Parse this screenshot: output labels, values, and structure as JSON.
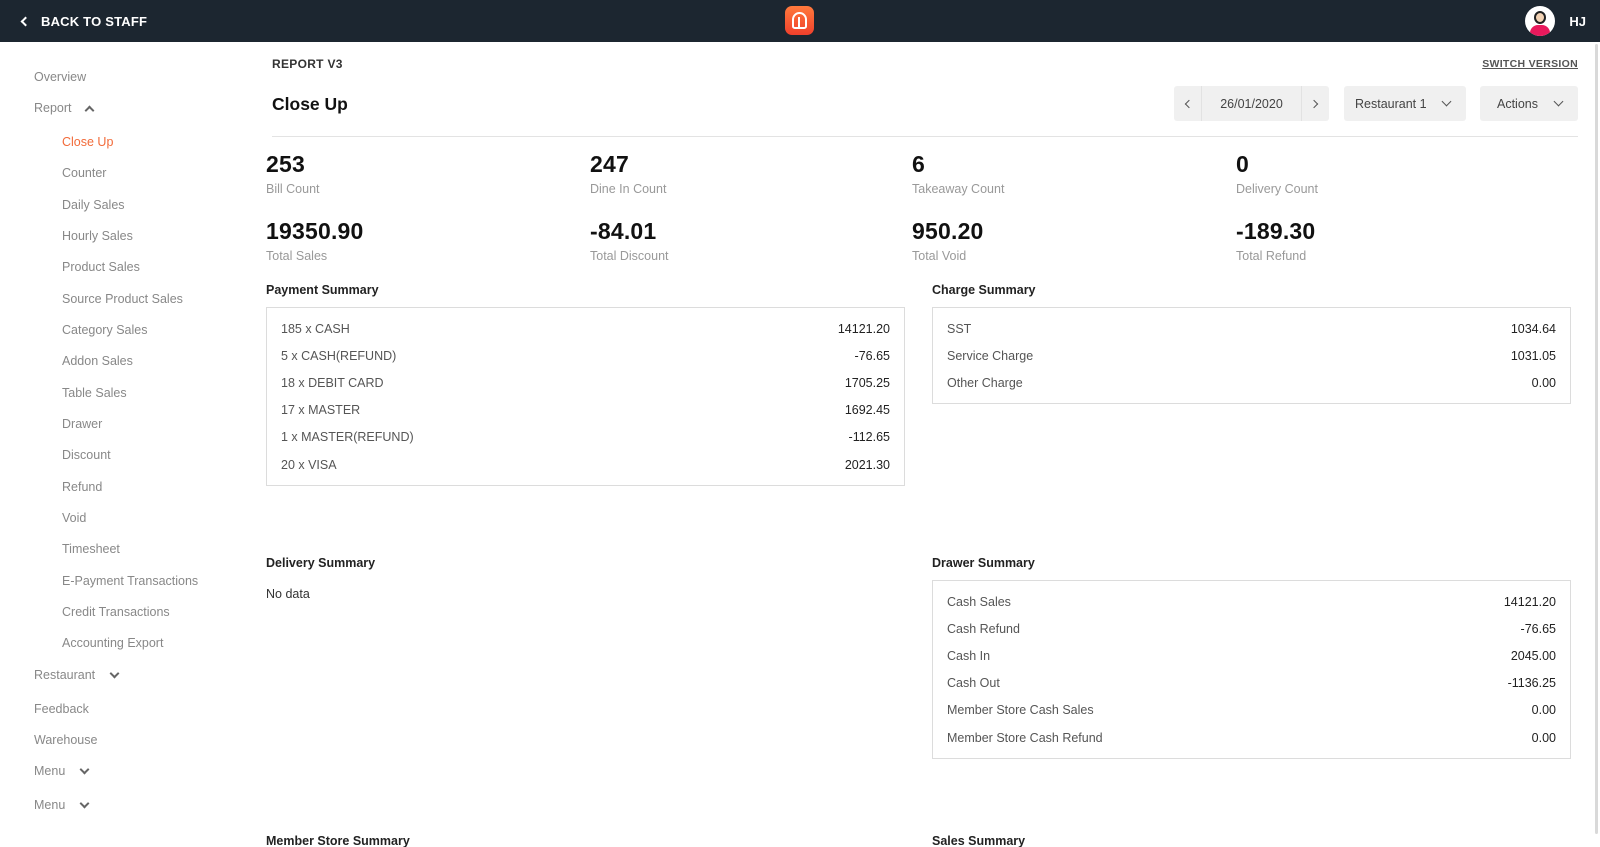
{
  "topbar": {
    "back_label": "BACK TO STAFF",
    "user_initials": "HJ",
    "brand_color": "#f0402c",
    "bar_color": "#1c2630"
  },
  "sidebar": {
    "overview": "Overview",
    "report": "Report",
    "report_items": [
      "Close Up",
      "Counter",
      "Daily Sales",
      "Hourly Sales",
      "Product Sales",
      "Source Product Sales",
      "Category Sales",
      "Addon Sales",
      "Table Sales",
      "Drawer",
      "Discount",
      "Refund",
      "Void",
      "Timesheet",
      "E-Payment Transactions",
      "Credit Transactions",
      "Accounting Export"
    ],
    "active_item": "Close Up",
    "active_color": "#f26b3a",
    "restaurant": "Restaurant",
    "feedback": "Feedback",
    "warehouse": "Warehouse",
    "menu_1": "Menu",
    "menu_2": "Menu"
  },
  "main": {
    "report_version": "REPORT V3",
    "switch_version": "SWITCH VERSION",
    "title": "Close Up",
    "date": "26/01/2020",
    "restaurant_select": "Restaurant 1",
    "actions_label": "Actions",
    "stats": [
      {
        "value": "253",
        "label": "Bill Count"
      },
      {
        "value": "247",
        "label": "Dine In Count"
      },
      {
        "value": "6",
        "label": "Takeaway Count"
      },
      {
        "value": "0",
        "label": "Delivery Count"
      },
      {
        "value": "19350.90",
        "label": "Total Sales"
      },
      {
        "value": "-84.01",
        "label": "Total Discount"
      },
      {
        "value": "950.20",
        "label": "Total Void"
      },
      {
        "value": "-189.30",
        "label": "Total Refund"
      }
    ],
    "payment_summary": {
      "title": "Payment Summary",
      "rows": [
        {
          "label": "185 x CASH",
          "value": "14121.20"
        },
        {
          "label": "5 x CASH(REFUND)",
          "value": "-76.65"
        },
        {
          "label": "18 x DEBIT CARD",
          "value": "1705.25"
        },
        {
          "label": "17 x MASTER",
          "value": "1692.45"
        },
        {
          "label": "1 x MASTER(REFUND)",
          "value": "-112.65"
        },
        {
          "label": "20 x VISA",
          "value": "2021.30"
        }
      ]
    },
    "charge_summary": {
      "title": "Charge Summary",
      "rows": [
        {
          "label": "SST",
          "value": "1034.64"
        },
        {
          "label": "Service Charge",
          "value": "1031.05"
        },
        {
          "label": "Other Charge",
          "value": "0.00"
        }
      ]
    },
    "delivery_summary": {
      "title": "Delivery Summary",
      "empty_text": "No data"
    },
    "drawer_summary": {
      "title": "Drawer Summary",
      "rows": [
        {
          "label": "Cash Sales",
          "value": "14121.20"
        },
        {
          "label": "Cash Refund",
          "value": "-76.65"
        },
        {
          "label": "Cash In",
          "value": "2045.00"
        },
        {
          "label": "Cash Out",
          "value": "-1136.25"
        },
        {
          "label": "Member Store Cash Sales",
          "value": "0.00"
        },
        {
          "label": "Member Store Cash Refund",
          "value": "0.00"
        }
      ]
    },
    "member_store_summary": {
      "title": "Member Store Summary"
    },
    "sales_summary": {
      "title": "Sales Summary"
    }
  }
}
